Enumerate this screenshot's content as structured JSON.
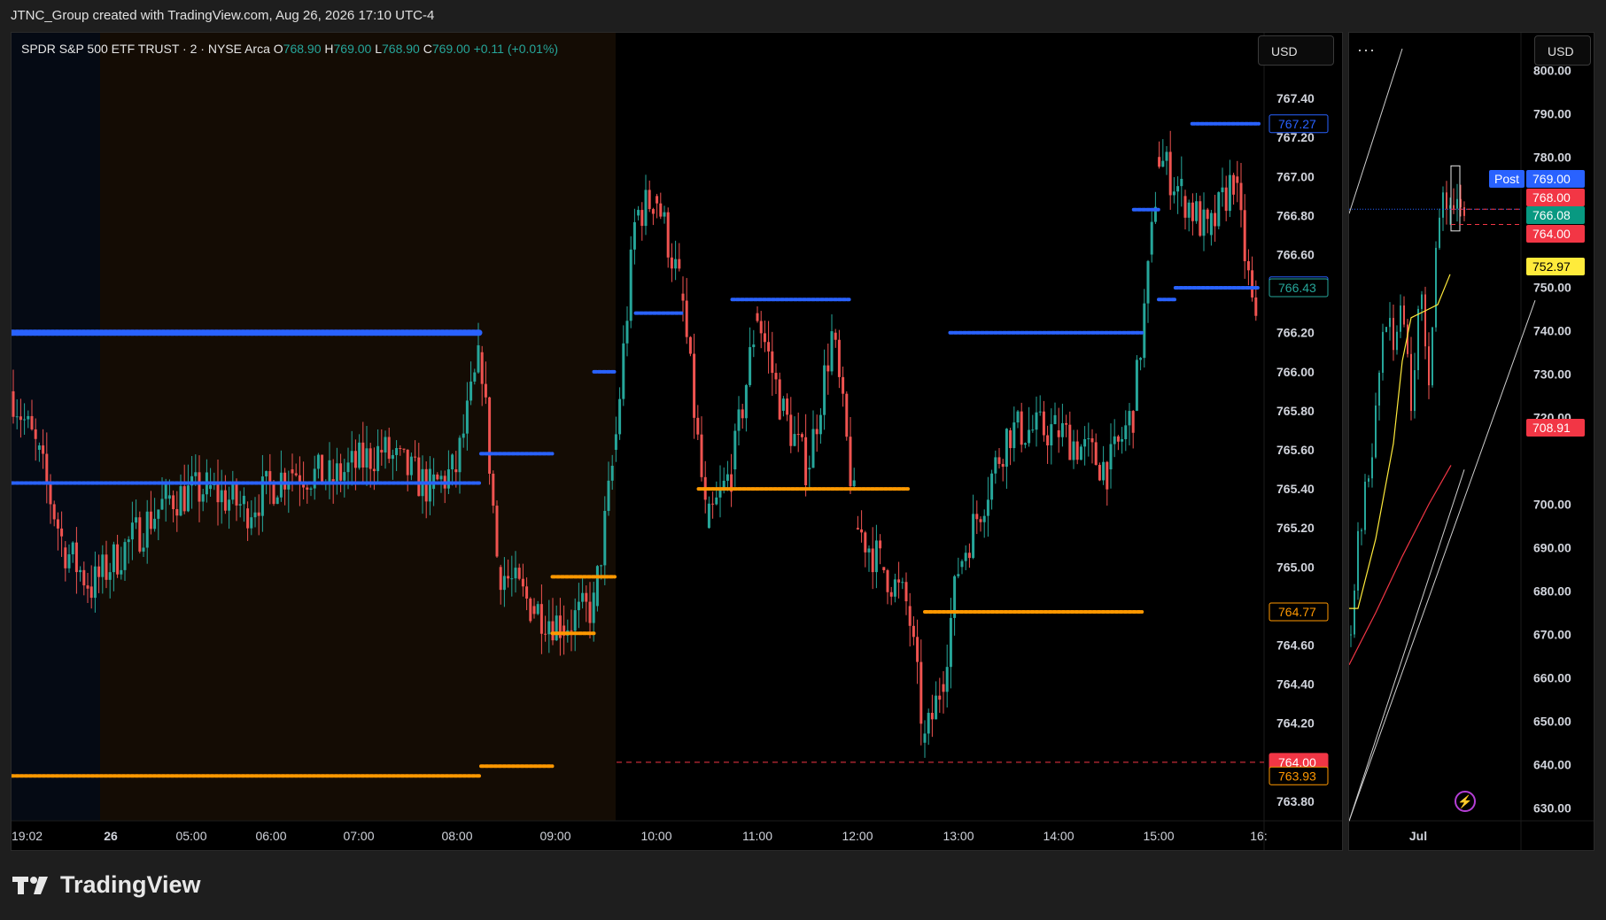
{
  "caption": "JTNC_Group created with TradingView.com, Aug 26, 2026 17:10 UTC-4",
  "brand": {
    "name": "TradingView"
  },
  "legend": {
    "symbol": "SPDR S&P 500 ETF TRUST · 2 · NYSE Arca",
    "o_label": "O",
    "o": "768.90",
    "h_label": "H",
    "h": "769.00",
    "l_label": "L",
    "l": "768.90",
    "c_label": "C",
    "c": "769.00",
    "change": "+0.11 (+0.01%)"
  },
  "currency": "USD",
  "more_label": "···",
  "colors": {
    "up": "#26a69a",
    "down": "#ef5350",
    "blue_levels": "#2962ff",
    "orange_levels": "#ff9800",
    "premarket_bg": "#140c04",
    "overnight_bg": "#050a14"
  },
  "chart_data": [
    {
      "type": "candlestick",
      "interval": "2",
      "ylim": [
        763.7,
        767.6
      ],
      "y_ticks": [
        "767.40",
        "767.20",
        "767.00",
        "766.80",
        "766.60",
        "766.20",
        "766.00",
        "765.80",
        "765.60",
        "765.40",
        "765.20",
        "765.00",
        "764.60",
        "764.40",
        "764.20",
        "763.80"
      ],
      "x_ticks": [
        "19:02",
        "26",
        "05:00",
        "06:00",
        "07:00",
        "08:00",
        "09:00",
        "10:00",
        "11:00",
        "12:00",
        "13:00",
        "14:00",
        "15:00",
        "16:"
      ],
      "price_labels": [
        {
          "text": "767.27",
          "value": 767.27,
          "style": "blue-outline"
        },
        {
          "text": "766.44",
          "value": 766.44,
          "style": "blue-outline"
        },
        {
          "text": "766.43",
          "value": 766.43,
          "style": "green-outline"
        },
        {
          "text": "764.77",
          "value": 764.77,
          "style": "orange-outline"
        },
        {
          "text": "764.00",
          "value": 764.0,
          "style": "red-fill"
        },
        {
          "text": "763.93",
          "value": 763.93,
          "style": "orange-outline"
        }
      ],
      "dashed_level": 764.0,
      "blue_levels": [
        {
          "from": "19:02",
          "to": "08:30",
          "value": 766.2
        },
        {
          "from": "19:02",
          "to": "08:30",
          "value": 765.43
        },
        {
          "from": "08:30",
          "to": "09:10",
          "value": 765.58
        },
        {
          "from": "09:30",
          "to": "09:40",
          "value": 766.0
        },
        {
          "from": "09:50",
          "to": "10:15",
          "value": 766.3
        },
        {
          "from": "10:45",
          "to": "11:55",
          "value": 766.37
        },
        {
          "from": "12:55",
          "to": "14:50",
          "value": 766.2
        },
        {
          "from": "14:45",
          "to": "15:00",
          "value": 766.83
        },
        {
          "from": "15:00",
          "to": "15:10",
          "value": 766.37
        },
        {
          "from": "15:10",
          "to": "16:00",
          "value": 766.43
        },
        {
          "from": "15:20",
          "to": "16:00",
          "value": 767.27
        }
      ],
      "orange_levels": [
        {
          "from": "19:02",
          "to": "08:30",
          "value": 763.93
        },
        {
          "from": "08:30",
          "to": "09:10",
          "value": 763.98
        },
        {
          "from": "09:10",
          "to": "09:40",
          "value": 764.95
        },
        {
          "from": "09:10",
          "to": "09:30",
          "value": 764.66
        },
        {
          "from": "10:25",
          "to": "12:30",
          "value": 765.4
        },
        {
          "from": "12:40",
          "to": "14:50",
          "value": 764.77
        }
      ],
      "path": [
        [
          "19:02",
          765.9
        ],
        [
          "19:30",
          765.6
        ],
        [
          "20:00",
          765.1
        ],
        [
          "20:30",
          764.9
        ],
        [
          "05:00",
          765.35
        ],
        [
          "05:30",
          765.4
        ],
        [
          "06:00",
          765.3
        ],
        [
          "06:30",
          765.5
        ],
        [
          "07:00",
          765.45
        ],
        [
          "07:30",
          765.6
        ],
        [
          "08:00",
          765.4
        ],
        [
          "08:15",
          765.5
        ],
        [
          "08:30",
          766.1
        ],
        [
          "08:40",
          765.0
        ],
        [
          "09:00",
          764.8
        ],
        [
          "09:15",
          764.7
        ],
        [
          "09:30",
          764.8
        ],
        [
          "09:40",
          765.6
        ],
        [
          "09:50",
          766.8
        ],
        [
          "10:00",
          766.9
        ],
        [
          "10:15",
          766.4
        ],
        [
          "10:30",
          765.2
        ],
        [
          "10:45",
          765.5
        ],
        [
          "11:00",
          766.3
        ],
        [
          "11:15",
          765.8
        ],
        [
          "11:30",
          765.5
        ],
        [
          "11:45",
          766.2
        ],
        [
          "12:00",
          765.2
        ],
        [
          "12:15",
          765.0
        ],
        [
          "12:30",
          764.8
        ],
        [
          "12:40",
          764.1
        ],
        [
          "12:50",
          764.4
        ],
        [
          "13:00",
          765.0
        ],
        [
          "13:30",
          765.7
        ],
        [
          "14:00",
          765.7
        ],
        [
          "14:30",
          765.5
        ],
        [
          "14:45",
          765.8
        ],
        [
          "14:55",
          766.6
        ],
        [
          "15:00",
          767.1
        ],
        [
          "15:15",
          766.9
        ],
        [
          "15:30",
          766.7
        ],
        [
          "15:45",
          767.0
        ],
        [
          "16:00",
          766.1
        ]
      ]
    },
    {
      "type": "candlestick",
      "interval": "daily",
      "ylim": [
        625,
        805
      ],
      "y_ticks": [
        "800.00",
        "790.00",
        "780.00",
        "750.00",
        "740.00",
        "730.00",
        "720.00",
        "700.00",
        "690.00",
        "680.00",
        "670.00",
        "660.00",
        "650.00",
        "640.00",
        "630.00"
      ],
      "x_ticks": [
        "Jul"
      ],
      "price_labels": [
        {
          "text": "769.00",
          "value": 769.0,
          "style": "blue-fill",
          "tag": "Post"
        },
        {
          "text": "768.00",
          "value": 768.0,
          "style": "red-fill"
        },
        {
          "text": "766.08",
          "value": 766.08,
          "style": "green-fill"
        },
        {
          "text": "764.00",
          "value": 764.0,
          "style": "red-fill"
        },
        {
          "text": "752.97",
          "value": 752.97,
          "style": "yellow-fill"
        },
        {
          "text": "708.91",
          "value": 708.91,
          "style": "red-fill"
        }
      ]
    }
  ]
}
